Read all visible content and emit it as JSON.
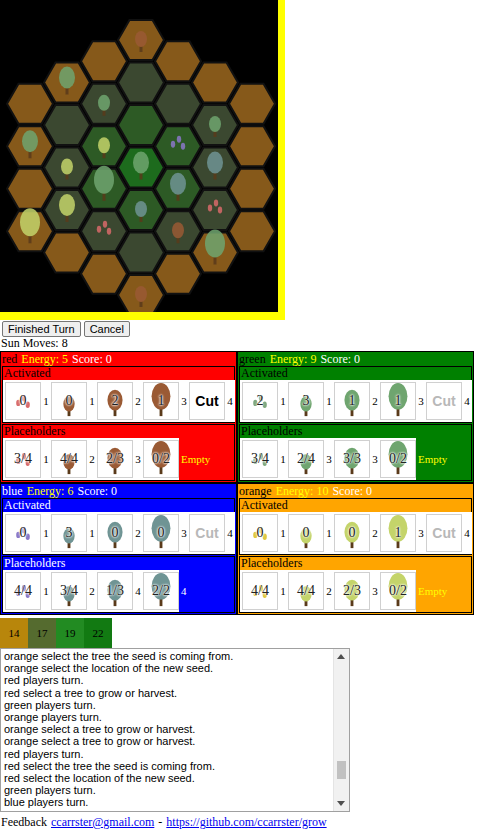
{
  "board": {
    "pieces": [
      {
        "q": 0,
        "r": -3,
        "owner": "red",
        "size": "small"
      },
      {
        "q": -2,
        "r": -1,
        "owner": "green",
        "size": "medium"
      },
      {
        "q": -1,
        "r": -1,
        "owner": "green",
        "size": "small"
      },
      {
        "q": -3,
        "r": 1,
        "owner": "green",
        "size": "medium"
      },
      {
        "q": -3,
        "r": 3,
        "owner": "orange",
        "size": "large"
      },
      {
        "q": -2,
        "r": 1,
        "owner": "orange",
        "size": "small"
      },
      {
        "q": -2,
        "r": 2,
        "owner": "orange",
        "size": "medium"
      },
      {
        "q": -1,
        "r": 0,
        "owner": "orange",
        "size": "small"
      },
      {
        "q": -1,
        "r": 1,
        "owner": "green",
        "size": "large"
      },
      {
        "q": -1,
        "r": 2,
        "owner": "red",
        "size": "seed"
      },
      {
        "q": 0,
        "r": 0,
        "owner": "green",
        "size": "medium"
      },
      {
        "q": 0,
        "r": 1,
        "owner": "blue",
        "size": "small"
      },
      {
        "q": 0,
        "r": 3,
        "owner": "red",
        "size": "small"
      },
      {
        "q": 1,
        "r": -1,
        "owner": "blue",
        "size": "seed"
      },
      {
        "q": 1,
        "r": 0,
        "owner": "blue",
        "size": "medium"
      },
      {
        "q": 1,
        "r": 1,
        "owner": "red",
        "size": "small"
      },
      {
        "q": 2,
        "r": -2,
        "owner": "green",
        "size": "small"
      },
      {
        "q": 2,
        "r": -1,
        "owner": "blue",
        "size": "medium"
      },
      {
        "q": 2,
        "r": 0,
        "owner": "red",
        "size": "seed"
      },
      {
        "q": 2,
        "r": 1,
        "owner": "green",
        "size": "large"
      }
    ]
  },
  "buttons": [
    {
      "label": "Finished Turn"
    },
    {
      "label": "Cancel"
    }
  ],
  "sun_moves": "Sun Moves: 8",
  "players": [
    {
      "name": "red",
      "energy": "Energy: 5",
      "score": "Score: 0",
      "color": "#ff0000",
      "ink": "#000000",
      "tree_color": "#9a5a34",
      "seed_color": "#d86a6a",
      "activated_label": "Activated",
      "activated": [
        {
          "kind": "seed",
          "count": "0",
          "cost": "1",
          "disabled": false
        },
        {
          "kind": "small",
          "count": "0",
          "cost": "1",
          "disabled": false
        },
        {
          "kind": "medium",
          "count": "2",
          "cost": "2",
          "disabled": false
        },
        {
          "kind": "large",
          "count": "1",
          "cost": "3",
          "disabled": false
        },
        {
          "kind": "cut",
          "count": "Cut",
          "cost": "4",
          "disabled": false
        }
      ],
      "placeholders_label": "Placeholders",
      "placeholders": [
        {
          "kind": "seed",
          "count": "3/4",
          "cost": "1",
          "empty": false
        },
        {
          "kind": "small",
          "count": "4/4",
          "cost": "2",
          "empty": false
        },
        {
          "kind": "medium",
          "count": "2/3",
          "cost": "3",
          "empty": false
        },
        {
          "kind": "large",
          "count": "0/2",
          "cost": "Empty",
          "empty": true
        }
      ]
    },
    {
      "name": "green",
      "energy": "Energy: 9",
      "score": "Score: 0",
      "color": "#008000",
      "ink": "#000000",
      "tree_color": "#6fa56f",
      "seed_color": "#7fa87f",
      "activated_label": "Activated",
      "activated": [
        {
          "kind": "seed",
          "count": "2",
          "cost": "1",
          "disabled": false
        },
        {
          "kind": "small",
          "count": "3",
          "cost": "1",
          "disabled": false
        },
        {
          "kind": "medium",
          "count": "1",
          "cost": "2",
          "disabled": false
        },
        {
          "kind": "large",
          "count": "1",
          "cost": "3",
          "disabled": false
        },
        {
          "kind": "cut",
          "count": "Cut",
          "cost": "4",
          "disabled": true
        }
      ],
      "placeholders_label": "Placeholders",
      "placeholders": [
        {
          "kind": "seed",
          "count": "3/4",
          "cost": "1",
          "empty": false
        },
        {
          "kind": "small",
          "count": "2/4",
          "cost": "3",
          "empty": false
        },
        {
          "kind": "medium",
          "count": "3/3",
          "cost": "3",
          "empty": false
        },
        {
          "kind": "large",
          "count": "0/2",
          "cost": "Empty",
          "empty": true
        }
      ]
    },
    {
      "name": "blue",
      "energy": "Energy: 6",
      "score": "Score: 0",
      "color": "#0000ff",
      "ink": "#ffffff",
      "tree_color": "#6f9494",
      "seed_color": "#8a78c8",
      "activated_label": "Activated",
      "activated": [
        {
          "kind": "seed",
          "count": "0",
          "cost": "1",
          "disabled": false
        },
        {
          "kind": "small",
          "count": "3",
          "cost": "1",
          "disabled": false
        },
        {
          "kind": "medium",
          "count": "0",
          "cost": "2",
          "disabled": false
        },
        {
          "kind": "large",
          "count": "0",
          "cost": "3",
          "disabled": false
        },
        {
          "kind": "cut",
          "count": "Cut",
          "cost": "4",
          "disabled": true
        }
      ],
      "placeholders_label": "Placeholders",
      "placeholders": [
        {
          "kind": "seed",
          "count": "4/4",
          "cost": "1",
          "empty": false
        },
        {
          "kind": "small",
          "count": "3/4",
          "cost": "2",
          "empty": false
        },
        {
          "kind": "medium",
          "count": "1/3",
          "cost": "4",
          "empty": false
        },
        {
          "kind": "large",
          "count": "2/2",
          "cost": "4",
          "empty": false
        }
      ]
    },
    {
      "name": "orange",
      "energy": "Energy: 10",
      "score": "Score: 0",
      "color": "#ffa500",
      "ink": "#000000",
      "tree_color": "#c4d46a",
      "seed_color": "#e0c840",
      "activated_label": "Activated",
      "activated": [
        {
          "kind": "seed",
          "count": "0",
          "cost": "1",
          "disabled": false
        },
        {
          "kind": "small",
          "count": "0",
          "cost": "1",
          "disabled": false
        },
        {
          "kind": "medium",
          "count": "0",
          "cost": "2",
          "disabled": false
        },
        {
          "kind": "large",
          "count": "1",
          "cost": "3",
          "disabled": false
        },
        {
          "kind": "cut",
          "count": "Cut",
          "cost": "4",
          "disabled": true
        }
      ],
      "placeholders_label": "Placeholders",
      "placeholders": [
        {
          "kind": "seed",
          "count": "4/4",
          "cost": "1",
          "empty": false
        },
        {
          "kind": "small",
          "count": "4/4",
          "cost": "2",
          "empty": false
        },
        {
          "kind": "medium",
          "count": "2/3",
          "cost": "3",
          "empty": false
        },
        {
          "kind": "large",
          "count": "0/2",
          "cost": "Empty",
          "empty": true
        }
      ]
    }
  ],
  "score_tokens": [
    {
      "value": "14",
      "color": "#b8860b"
    },
    {
      "value": "17",
      "color": "#556b2f"
    },
    {
      "value": "19",
      "color": "#228b22"
    },
    {
      "value": "22",
      "color": "#127a12"
    }
  ],
  "log": {
    "scroll_level": 0.85,
    "lines": [
      "orange select the tree the seed is coming from.",
      "orange select the location of the new seed.",
      "red players turn.",
      "red select a tree to grow or harvest.",
      "green players turn.",
      "orange players turn.",
      "orange select a tree to grow or harvest.",
      "orange select a tree to grow or harvest.",
      "red players turn.",
      "red select the tree the seed is coming from.",
      "red select the location of the new seed.",
      "green players turn.",
      "blue players turn."
    ]
  },
  "footer": {
    "prefix": "Feedback",
    "email": "ccarrster@gmail.com",
    "separator": "-",
    "repo": "https://github.com/ccarrster/grow"
  }
}
